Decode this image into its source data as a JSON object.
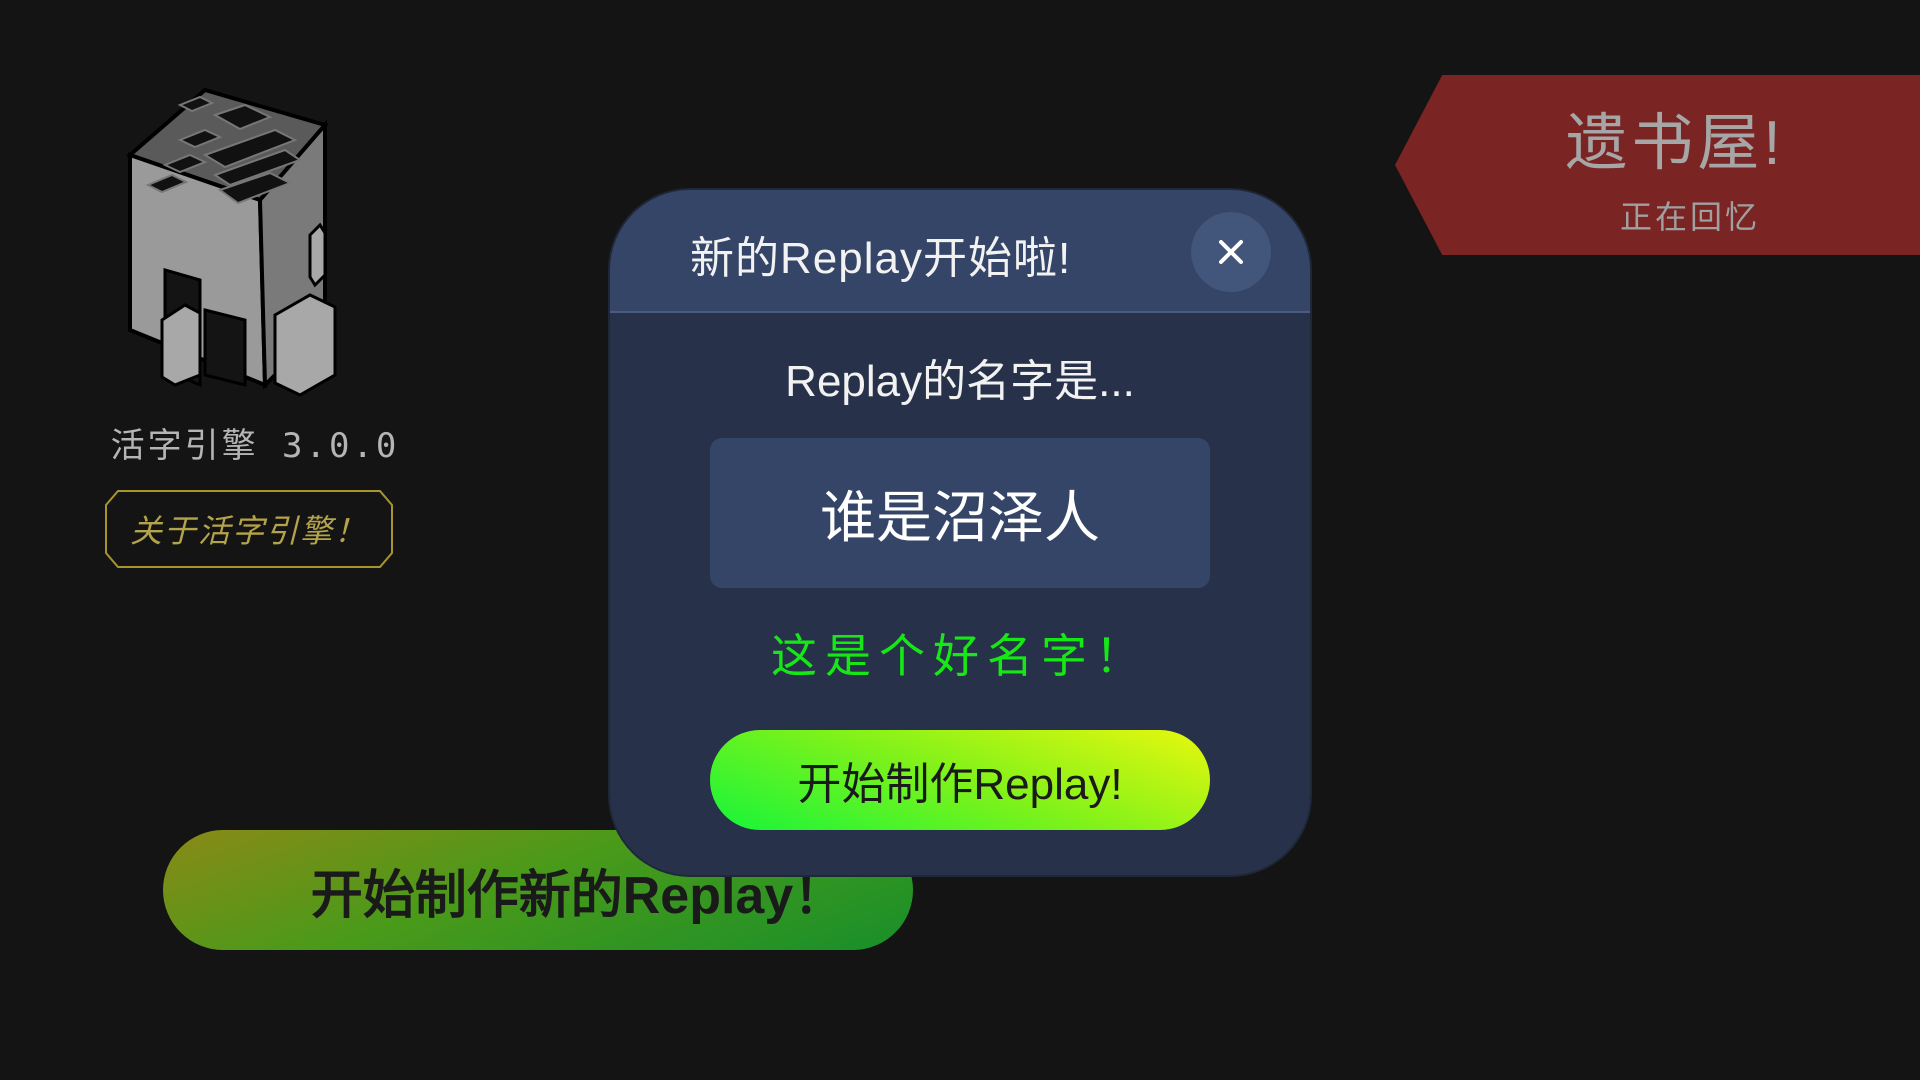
{
  "app": {
    "version_label": "活字引擎 3.0.0",
    "about_button": "关于活字引擎！",
    "new_replay_button": "开始制作新的Replay！"
  },
  "banner": {
    "title": "遗书屋!",
    "subtitle": "正在回忆"
  },
  "dialog": {
    "title": "新的Replay开始啦!",
    "close_icon": "close-icon",
    "label": "Replay的名字是...",
    "name_value": "谁是沼泽人",
    "validation_message": "这是个好名字！",
    "start_button": "开始制作Replay!"
  },
  "icons": {
    "logo": "movable-type-block-logo",
    "close": "close-icon"
  },
  "colors": {
    "background": "#141414",
    "dialog_bg": "#27324a",
    "dialog_header": "#344567",
    "valid_text": "#16e816",
    "banner_red": "#7b2424",
    "about_border": "#a7952c"
  }
}
